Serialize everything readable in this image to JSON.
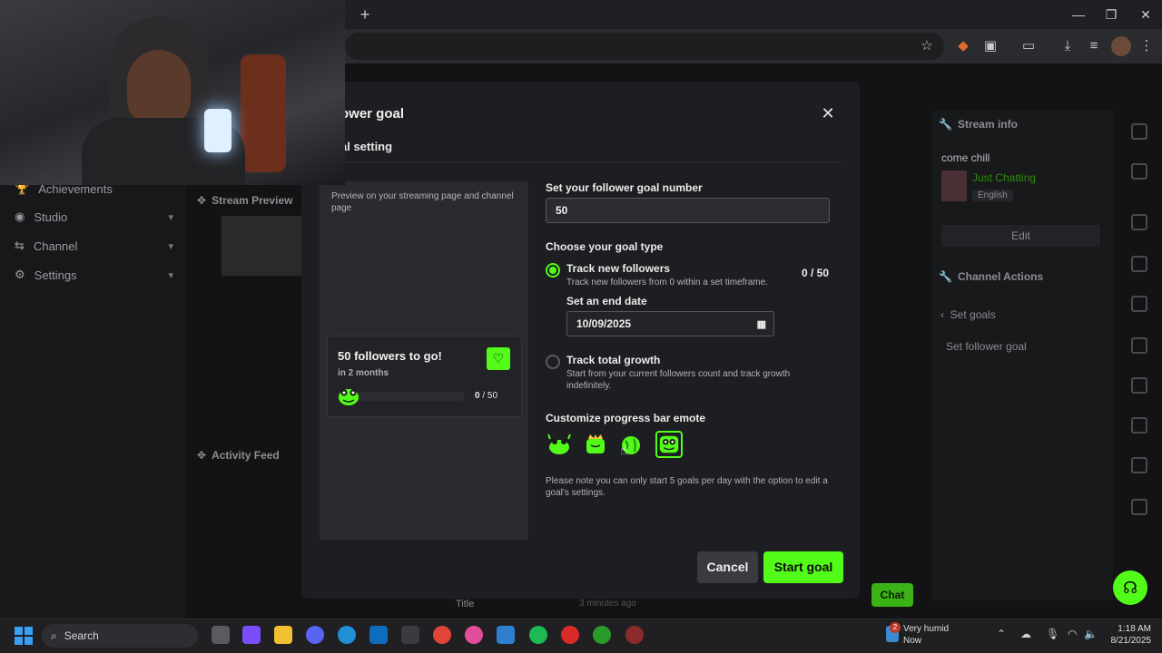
{
  "browser": {
    "new_tab_glyph": "+",
    "window_controls": [
      "—",
      "❐",
      "✕"
    ],
    "toolbar_icons": [
      "star-icon",
      "extension-icon",
      "puzzle-icon",
      "cast-icon",
      "download-icon",
      "media-icon",
      "profile-avatar",
      "menu-icon"
    ]
  },
  "sidebar": {
    "items": [
      {
        "label": "Achievements",
        "icon": "trophy-icon"
      },
      {
        "label": "Studio",
        "icon": "studio-icon"
      },
      {
        "label": "Channel",
        "icon": "channel-icon"
      },
      {
        "label": "Settings",
        "icon": "gear-icon"
      }
    ]
  },
  "panels": {
    "stream_preview": "Stream Preview",
    "activity_feed": "Activity Feed",
    "stream_info": "Stream info",
    "stream_title": "come chill",
    "category": "Just Chatting",
    "language": "English",
    "edit": "Edit",
    "channel_actions": "Channel Actions",
    "set_goals": "Set goals",
    "set_follower_goal": "Set follower goal",
    "chat_button": "Chat",
    "feed_title": "Title",
    "feed_time": "3 minutes ago"
  },
  "modal": {
    "title": "ower goal",
    "subtitle": "al setting",
    "preview_note": "Preview on your streaming page and channel page",
    "card": {
      "title": "50 followers to go!",
      "subtitle": "in 2 months",
      "count_current": "0",
      "count_total": " / 50",
      "progress": 0.0
    },
    "goal_number_label": "Set your follower goal number",
    "goal_number_value": "50",
    "goal_type_label": "Choose your goal type",
    "option_new": {
      "title": "Track new followers",
      "desc": "Track new followers from 0 within a set timeframe.",
      "count": "0 / 50",
      "selected": true
    },
    "end_date_label": "Set an end date",
    "end_date_value": "10/09/2025",
    "option_total": {
      "title": "Track total growth",
      "desc": "Start from your current followers count and track growth indefinitely.",
      "selected": false
    },
    "emote_label": "Customize progress bar emote",
    "emotes": [
      "emote-frog-cheer",
      "emote-frog-crown",
      "emote-frog-globe",
      "emote-frog-face"
    ],
    "selected_emote_index": 3,
    "note": "Please note you can only start 5 goals per day with the option to edit a goal's settings.",
    "cancel": "Cancel",
    "start": "Start goal",
    "close_glyph": "✕"
  },
  "colors": {
    "accent": "#53fc18",
    "modal_bg": "#1d1e21"
  },
  "taskbar": {
    "search_placeholder": "Search",
    "weather_title": "Very humid",
    "weather_sub": "Now",
    "weather_badge": "2",
    "time": "1:18 AM",
    "date": "8/21/2025"
  }
}
